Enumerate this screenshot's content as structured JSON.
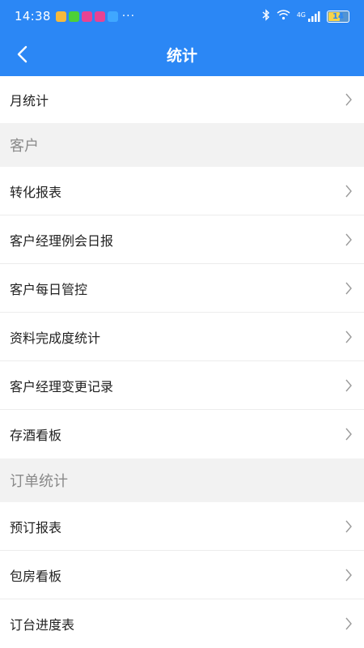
{
  "status_bar": {
    "time": "14:38",
    "more": "···",
    "network": "4G",
    "battery": "14",
    "battery_level": 0.14,
    "app_icon_colors": [
      "#f6b93b",
      "#4cd137",
      "#e84393",
      "#e84393",
      "#3fa7ff"
    ]
  },
  "header": {
    "title": "统计",
    "back_icon": "chevron-left-icon",
    "background": "#2b87f5"
  },
  "top_item": {
    "label": "月统计"
  },
  "sections": [
    {
      "title": "客户",
      "items": [
        {
          "label": "转化报表"
        },
        {
          "label": "客户经理例会日报"
        },
        {
          "label": "客户每日管控"
        },
        {
          "label": "资料完成度统计"
        },
        {
          "label": "客户经理变更记录"
        },
        {
          "label": "存酒看板"
        }
      ]
    },
    {
      "title": "订单统计",
      "items": [
        {
          "label": "预订报表"
        },
        {
          "label": "包房看板"
        },
        {
          "label": "订台进度表"
        }
      ]
    }
  ]
}
